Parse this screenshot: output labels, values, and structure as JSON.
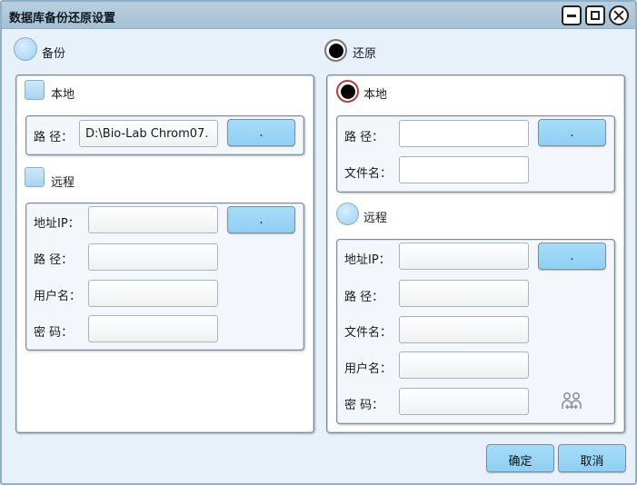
{
  "window": {
    "title": "数据库备份还原设置"
  },
  "backup": {
    "label": "备份",
    "local": {
      "label": "本地",
      "path_label": "路 径：",
      "path_value": "D:\\Bio-Lab Chrom07.",
      "browse_label": "."
    },
    "remote": {
      "label": "远程",
      "ip_label": "地址IP：",
      "path_label": "路 径：",
      "user_label": "用户名：",
      "password_label": "密 码：",
      "browse_label": "."
    }
  },
  "restore": {
    "label": "还原",
    "local": {
      "label": "本地",
      "path_label": "路 径：",
      "filename_label": "文件名：",
      "browse_label": "."
    },
    "remote": {
      "label": "远程",
      "ip_label": "地址IP：",
      "path_label": "路 径：",
      "filename_label": "文件名：",
      "user_label": "用户名：",
      "password_label": "密 码：",
      "browse_label": ".",
      "icon": "users-icon"
    }
  },
  "footer": {
    "ok_label": "确定",
    "cancel_label": "取消"
  }
}
